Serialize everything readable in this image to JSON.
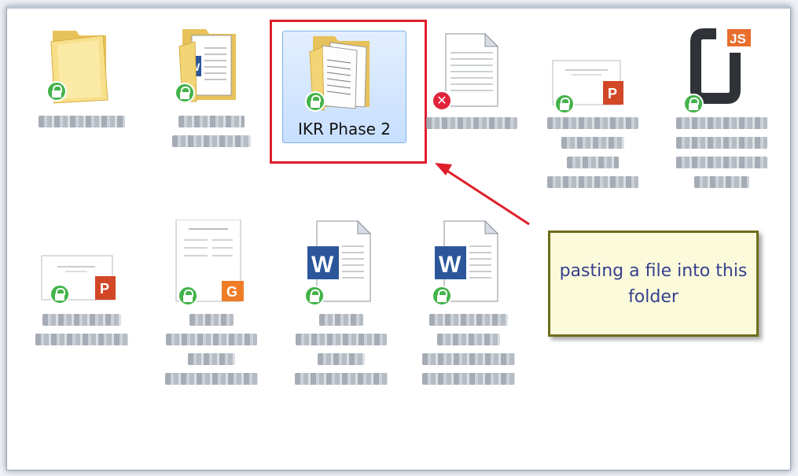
{
  "folder": {
    "selected_item_label": "IKR Phase 2"
  },
  "callout": {
    "text": "pasting a file into this folder"
  },
  "colors": {
    "selection_highlight": "#c7dfff",
    "annotation_red": "#e01e2a",
    "callout_background": "#fbfbdc",
    "callout_border": "#6f6d1a",
    "callout_text": "#37408c",
    "lock_badge": "#43b34a"
  },
  "items": [
    {
      "type": "folder",
      "badge": "lock-icon"
    },
    {
      "type": "folder-with-word-document",
      "badge": "lock-icon"
    },
    {
      "type": "folder-with-documents",
      "badge": "lock-icon"
    },
    {
      "type": "text-file",
      "badge": "error-icon"
    },
    {
      "type": "powerpoint-file",
      "badge": "lock-icon"
    },
    {
      "type": "javascript-file",
      "badge": "lock-icon"
    },
    {
      "type": "powerpoint-file",
      "badge": "lock-icon"
    },
    {
      "type": "form-document",
      "badge": "lock-icon"
    },
    {
      "type": "word-document",
      "badge": "lock-icon"
    },
    {
      "type": "word-document",
      "badge": "lock-icon"
    }
  ]
}
